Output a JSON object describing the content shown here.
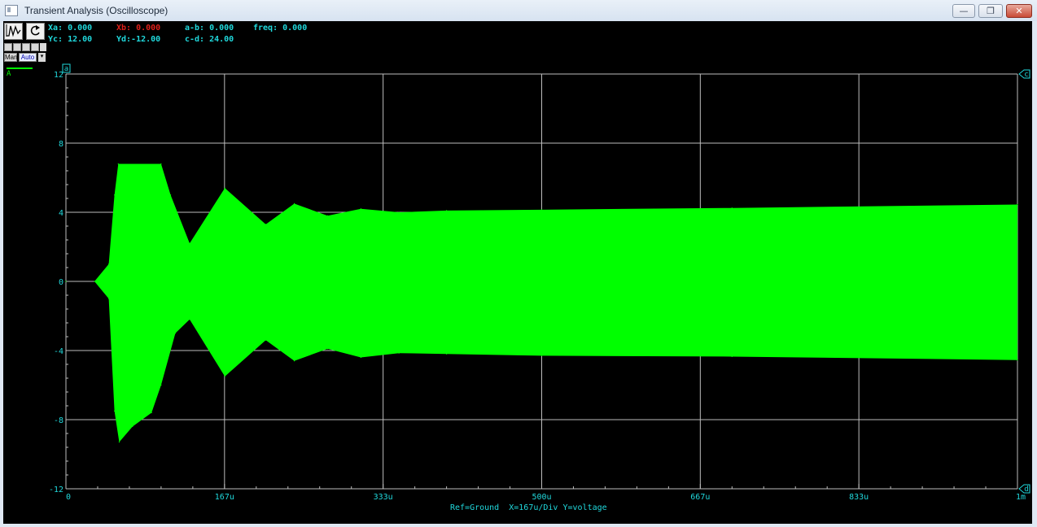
{
  "window": {
    "title": "Transient Analysis (Oscilloscope)",
    "controls": {
      "minimize": "—",
      "maximize": "❐",
      "close": "✕"
    }
  },
  "toolbar": {
    "wave_icon": "waveform-icon",
    "reset_icon": "reset-icon",
    "man_label": "Man",
    "auto_label": "Auto"
  },
  "readouts": {
    "xa": "Xa: 0.000",
    "xb": "Xb: 0.000",
    "ab": "a-b: 0.000",
    "freq": "freq: 0.000",
    "yc": "Yc: 12.00",
    "yd": "Yd:-12.00",
    "cd": "c-d: 24.00"
  },
  "channel": {
    "name": "A",
    "color": "#00ff00"
  },
  "colors": {
    "accent": "#20d8dc",
    "trace": "#00ff00",
    "cursor_b": "#e0201a",
    "background": "#000000"
  },
  "cursors": {
    "a": "a",
    "c": "c",
    "d": "d"
  },
  "footer": "Ref=Ground  X=167u/Div Y=voltage",
  "chart_data": {
    "type": "area",
    "title": "",
    "xlabel": "",
    "ylabel": "",
    "x_ticks": [
      "0",
      "167u",
      "333u",
      "500u",
      "667u",
      "833u",
      "1m"
    ],
    "y_ticks": [
      "12",
      "8",
      "4",
      "0",
      "-4",
      "-8",
      "-12"
    ],
    "xlim": [
      0,
      0.001
    ],
    "ylim": [
      -12,
      12
    ],
    "grid": true,
    "series": [
      {
        "color": "#00ff00",
        "upper": [
          [
            0,
            0
          ],
          [
            3e-05,
            0
          ],
          [
            4.5e-05,
            1.0
          ],
          [
            5.1e-05,
            5.0
          ],
          [
            5.5e-05,
            6.8
          ],
          [
            0.0001,
            6.8
          ],
          [
            0.00011,
            5.0
          ],
          [
            0.00013,
            2.2
          ],
          [
            0.000167,
            5.4
          ],
          [
            0.00021,
            3.3
          ],
          [
            0.00024,
            4.5
          ],
          [
            0.000275,
            3.8
          ],
          [
            0.00031,
            4.2
          ],
          [
            0.00035,
            4.0
          ],
          [
            0.0004,
            4.1
          ],
          [
            0.0005,
            4.15
          ],
          [
            0.0007,
            4.25
          ],
          [
            0.001,
            4.45
          ]
        ],
        "lower": [
          [
            0,
            0
          ],
          [
            3e-05,
            0
          ],
          [
            4.5e-05,
            -1.0
          ],
          [
            5.1e-05,
            -7.5
          ],
          [
            5.6e-05,
            -9.3
          ],
          [
            7e-05,
            -8.4
          ],
          [
            9e-05,
            -7.6
          ],
          [
            0.0001,
            -6.0
          ],
          [
            0.000115,
            -3.0
          ],
          [
            0.00013,
            -2.2
          ],
          [
            0.000167,
            -5.5
          ],
          [
            0.00021,
            -3.4
          ],
          [
            0.00024,
            -4.6
          ],
          [
            0.000275,
            -3.9
          ],
          [
            0.00031,
            -4.4
          ],
          [
            0.00035,
            -4.15
          ],
          [
            0.0004,
            -4.2
          ],
          [
            0.0005,
            -4.3
          ],
          [
            0.0007,
            -4.35
          ],
          [
            0.001,
            -4.55
          ]
        ]
      }
    ]
  }
}
